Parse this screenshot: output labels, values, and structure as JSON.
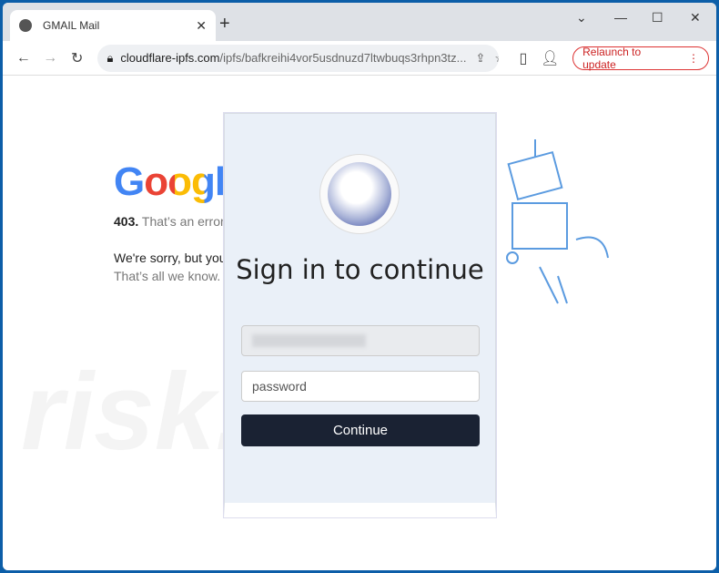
{
  "browser": {
    "tab_title": "GMAIL Mail",
    "url_domain": "cloudflare-ipfs.com",
    "url_path": "/ipfs/bafkreihi4vor5usdnuzd7ltwbuqs3rhpn3tz...",
    "relaunch_label": "Relaunch to update"
  },
  "background_page": {
    "logo": "Google",
    "error_code": "403.",
    "error_text": "That’s an error.",
    "sorry": "We're sorry, but you",
    "know": "That’s all we know."
  },
  "watermark": "risk.com",
  "form": {
    "title": "Sign in to continue",
    "password_placeholder": "password",
    "continue_label": "Continue"
  }
}
